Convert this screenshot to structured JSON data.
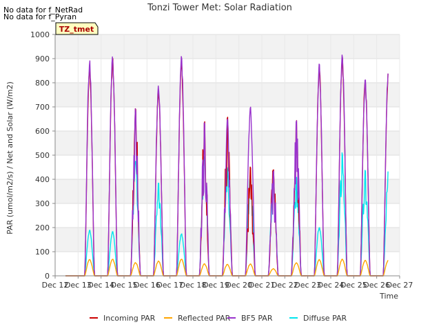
{
  "no_data_notes": [
    "No data for f_NetRad",
    "No data for f_Pyran"
  ],
  "site_badge": "TZ_tmet",
  "chart_data": {
    "type": "line",
    "title": "Tonzi Tower Met: Solar Radiation",
    "xlabel": "Time",
    "ylabel": "PAR (umol/m2/s) / Net and Solar (W/m2)",
    "ylim": [
      0,
      1000
    ],
    "yticks": [
      0,
      100,
      200,
      300,
      400,
      500,
      600,
      700,
      800,
      900,
      1000
    ],
    "xlim": [
      12,
      27
    ],
    "xticks": [
      {
        "x": 12,
        "label": "Dec 12"
      },
      {
        "x": 13,
        "label": "Dec 13"
      },
      {
        "x": 14,
        "label": "Dec 14"
      },
      {
        "x": 15,
        "label": "Dec 15"
      },
      {
        "x": 16,
        "label": "Dec 16"
      },
      {
        "x": 17,
        "label": "Dec 17"
      },
      {
        "x": 18,
        "label": "Dec 18"
      },
      {
        "x": 19,
        "label": "Dec 19"
      },
      {
        "x": 20,
        "label": "Dec 20"
      },
      {
        "x": 21,
        "label": "Dec 21"
      },
      {
        "x": 22,
        "label": "Dec 22"
      },
      {
        "x": 23,
        "label": "Dec 23"
      },
      {
        "x": 24,
        "label": "Dec 24"
      },
      {
        "x": 25,
        "label": "Dec 25"
      },
      {
        "x": 26,
        "label": "Dec 26"
      },
      {
        "x": 27,
        "label": "Dec 27"
      }
    ],
    "grid": true,
    "legend_position": "bottom",
    "x_data_range": [
      12.45,
      26.5
    ],
    "days": [
      13,
      14,
      15,
      16,
      17,
      18,
      19,
      20,
      21,
      22,
      23,
      24,
      25,
      26
    ],
    "series": [
      {
        "name": "Incoming PAR",
        "color": "#cc0000",
        "peaks": [
          870,
          900,
          695,
          770,
          890,
          645,
          660,
          455,
          450,
          655,
          870,
          905,
          815,
          850
        ]
      },
      {
        "name": "Reflected PAR",
        "color": "#ffa500",
        "peaks": [
          68,
          70,
          55,
          62,
          70,
          50,
          48,
          50,
          30,
          55,
          68,
          70,
          65,
          65
        ]
      },
      {
        "name": "BF5 PAR",
        "color": "#9933cc",
        "peaks": [
          898,
          912,
          695,
          788,
          912,
          640,
          655,
          700,
          440,
          655,
          878,
          915,
          820,
          855
        ]
      },
      {
        "name": "Diffuse PAR",
        "color": "#00e5ee",
        "peaks": [
          190,
          185,
          485,
          395,
          175,
          500,
          450,
          420,
          420,
          410,
          205,
          510,
          440,
          445
        ]
      }
    ]
  }
}
